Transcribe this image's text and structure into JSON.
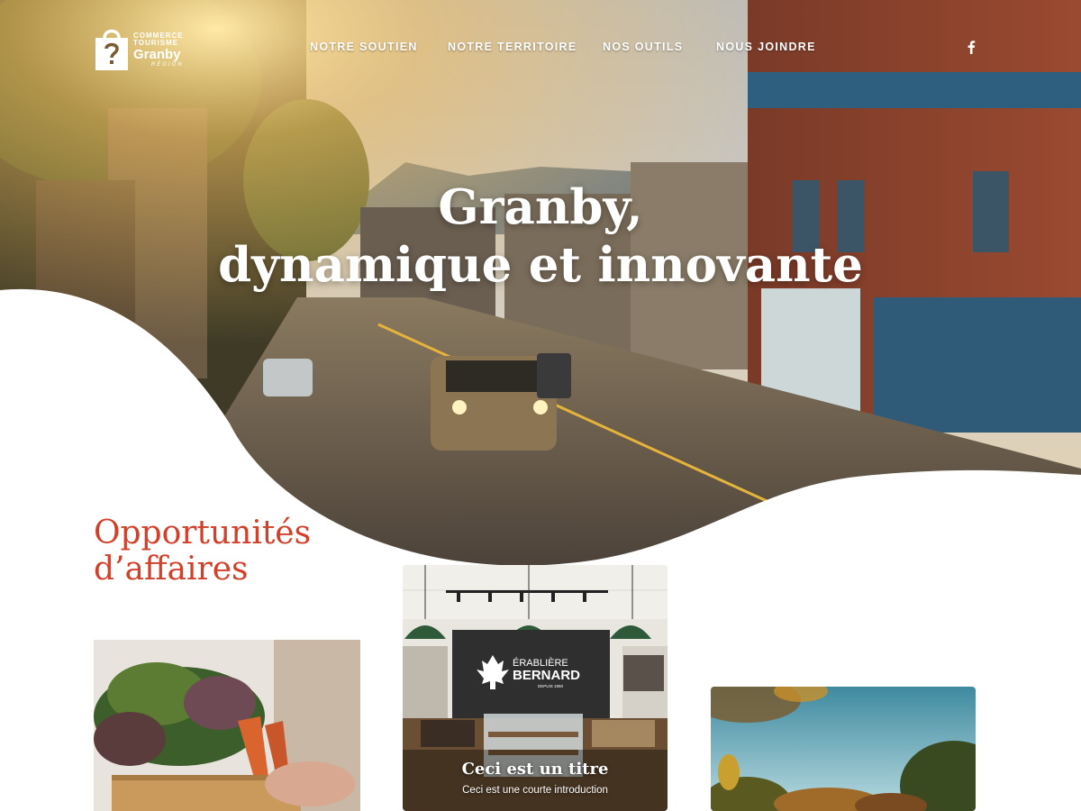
{
  "logo": {
    "line1": "COMMERCE",
    "line2": "TOURISME",
    "line3": "Granby",
    "line4": "RÉGION",
    "icon": "shopping-bag-question-icon"
  },
  "nav": {
    "links": [
      {
        "label": "NOTRE SOUTIEN"
      },
      {
        "label": "NOTRE TERRITOIRE"
      },
      {
        "label": "NOS OUTILS"
      },
      {
        "label": "NOUS JOINDRE"
      }
    ],
    "social_icon": "facebook-icon"
  },
  "hero": {
    "title_line1": "Granby,",
    "title_line2": "dynamique et innovante"
  },
  "section": {
    "title_line1": "Opportunités",
    "title_line2": "d’affaires"
  },
  "cards": [
    {
      "image": "vegetable-crate-photo"
    },
    {
      "image": "erabliere-bernard-shop-photo",
      "sign_line1": "ÉRABLIÈRE",
      "sign_line2": "BERNARD",
      "sign_line3": "DEPUIS 1950",
      "title": "Ceci est un titre",
      "intro": "Ceci est une courte introduction"
    },
    {
      "image": "autumn-trees-photo"
    }
  ],
  "colors": {
    "accent": "#d2402a",
    "nav_text": "#ffffff",
    "background": "#ffffff"
  }
}
